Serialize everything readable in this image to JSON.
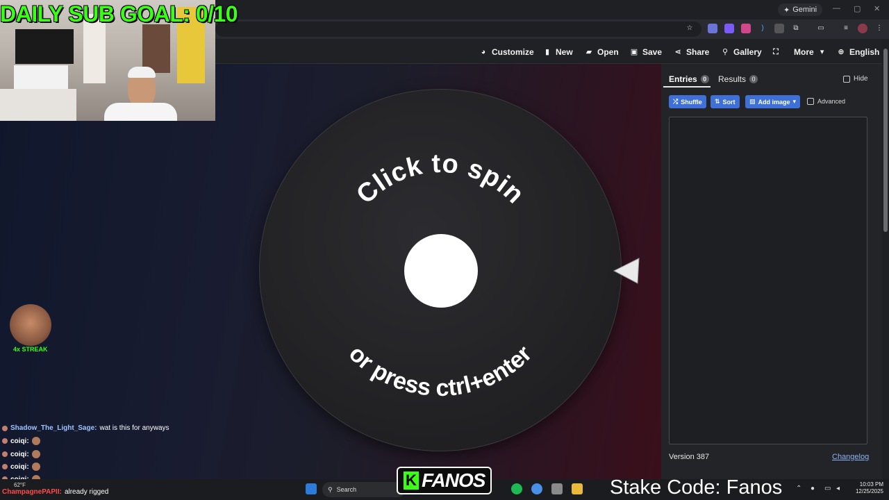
{
  "browser": {
    "gemini_label": "Gemini",
    "window_controls": [
      "—",
      "▢",
      "✕"
    ]
  },
  "toolbar": {
    "customize": "Customize",
    "new": "New",
    "open": "Open",
    "save": "Save",
    "share": "Share",
    "gallery": "Gallery",
    "more": "More",
    "language": "English"
  },
  "wheel": {
    "top_text": "Click to spin",
    "bottom_text": "or press ctrl+enter"
  },
  "panel": {
    "tab_entries": "Entries",
    "entries_count": "0",
    "tab_results": "Results",
    "results_count": "0",
    "hide_label": "Hide",
    "shuffle": "Shuffle",
    "sort": "Sort",
    "add_image": "Add image",
    "advanced": "Advanced",
    "version": "Version 387",
    "changelog": "Changelog"
  },
  "overlay": {
    "goal": "DAILY SUB GOAL: 0/10",
    "streak": "4x STREAK",
    "chat": [
      {
        "user": "Shadow_The_Light_Sage:",
        "message": "wat is this for anyways"
      },
      {
        "user": "coiqi:",
        "message": ""
      },
      {
        "user": "coiqi:",
        "message": ""
      },
      {
        "user": "coiqi:",
        "message": ""
      },
      {
        "user": "coiqi:",
        "message": ""
      },
      {
        "user": "ChampagnePAPII:",
        "message": "already rigged"
      }
    ],
    "brand": "FANOS",
    "brand_letter": "K",
    "stake_code": "Stake Code: Fanos"
  },
  "taskbar": {
    "search": "Search",
    "weather": "62°F",
    "time": "10:03 PM",
    "date": "12/25/2025"
  }
}
